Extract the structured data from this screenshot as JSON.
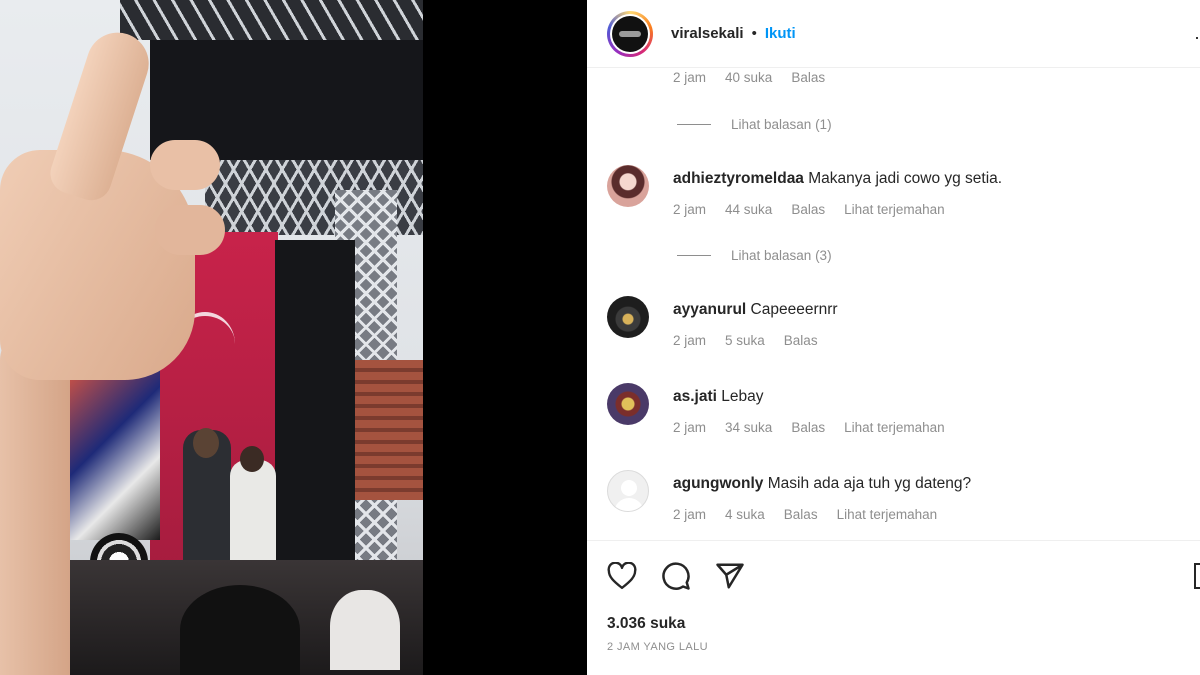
{
  "post": {
    "username": "viralsekali",
    "separator": "•",
    "follow_label": "Ikuti"
  },
  "top_partial_comment": {
    "time": "2 jam",
    "likes": "40 suka",
    "reply": "Balas"
  },
  "view_replies": [
    {
      "label": "Lihat balasan (1)"
    },
    {
      "label": "Lihat balasan (3)"
    }
  ],
  "comments": [
    {
      "username": "adhieztyromeldaa",
      "text": "Makanya jadi cowo yg setia.",
      "time": "2 jam",
      "likes": "44 suka",
      "reply": "Balas",
      "translate": "Lihat terjemahan"
    },
    {
      "username": "ayyanurul",
      "text": "Capeeeernrr",
      "time": "2 jam",
      "likes": "5 suka",
      "reply": "Balas",
      "translate": ""
    },
    {
      "username": "as.jati",
      "text": "Lebay",
      "time": "2 jam",
      "likes": "34 suka",
      "reply": "Balas",
      "translate": "Lihat terjemahan"
    },
    {
      "username": "agungwonly",
      "text": "Masih ada aja tuh yg dateng?",
      "time": "2 jam",
      "likes": "4 suka",
      "reply": "Balas",
      "translate": "Lihat terjemahan"
    }
  ],
  "actions": {
    "like_icon": "heart-icon",
    "comment_icon": "comment-icon",
    "share_icon": "send-icon",
    "save_icon": "bookmark-icon"
  },
  "stats": {
    "likes": "3.036 suka",
    "time_ago": "2 JAM YANG LALU"
  },
  "colors": {
    "follow_blue": "#0095f6",
    "secondary_text": "#8e8e8e",
    "primary_text": "#262626"
  }
}
